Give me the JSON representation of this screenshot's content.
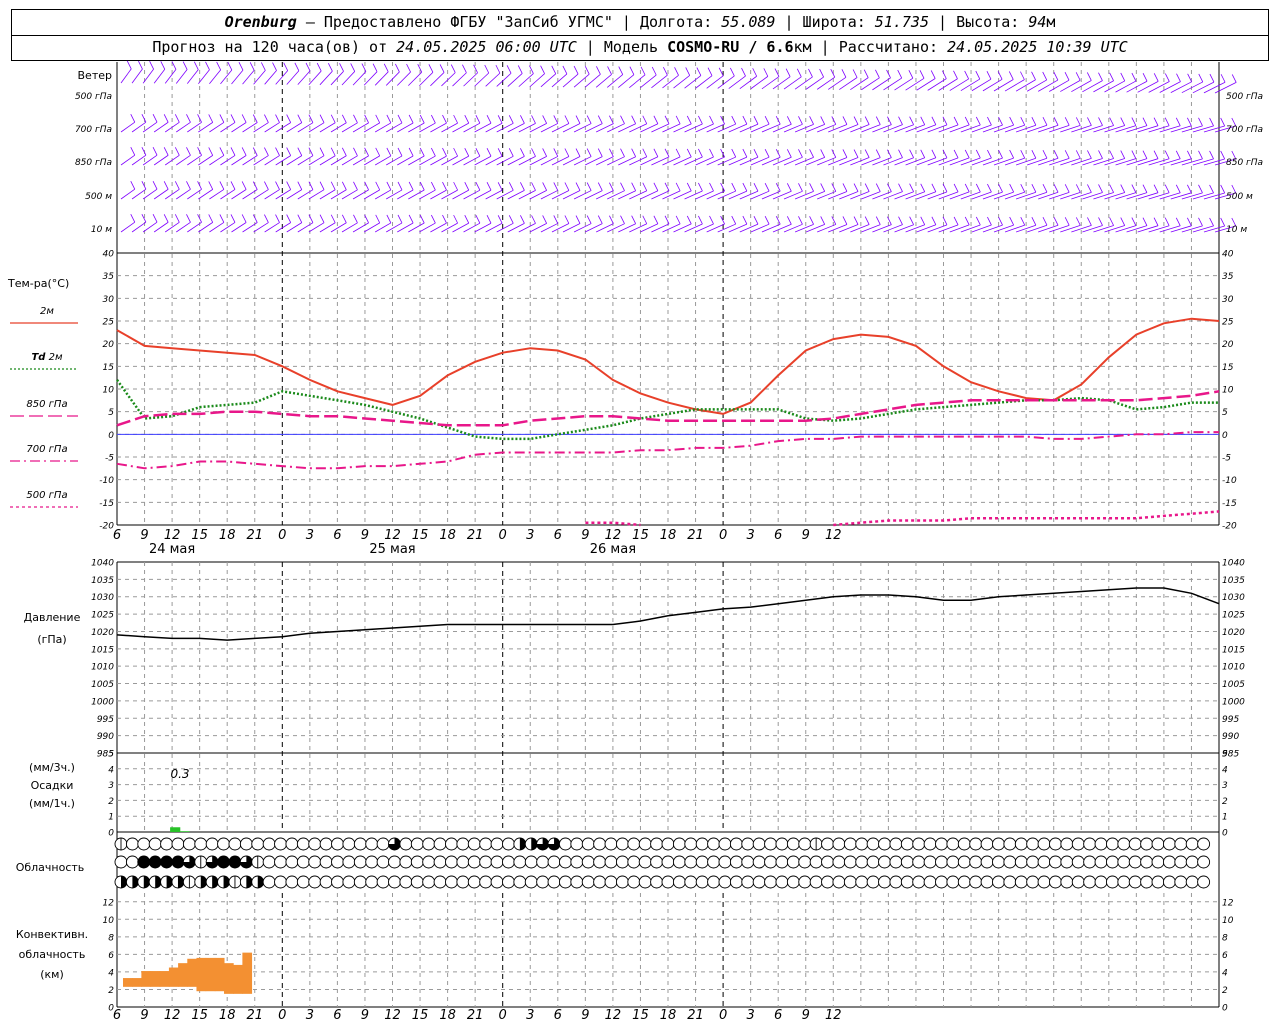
{
  "header": {
    "city": "Orenburg",
    "provided_by": "Предоставлено ФГБУ \"ЗапСиб УГМС\"",
    "lon_label": "Долгота:",
    "lon_value": "55.089",
    "lat_label": "Широта:",
    "lat_value": "51.735",
    "alt_label": "Высота:",
    "alt_value": "94",
    "alt_unit": "м",
    "forecast_text": "Прогноз на 120 часа(ов) от",
    "forecast_start": "24.05.2025 06:00 UTC",
    "model_label": "Модель",
    "model_name": "COSMO-RU / 6.6",
    "model_unit": "км",
    "calc_label": "Рассчитано:",
    "calc_time": "24.05.2025 10:39 UTC"
  },
  "time_axis": {
    "hour_labels": [
      "6",
      "9",
      "12",
      "15",
      "18",
      "21",
      "0",
      "3",
      "6",
      "9",
      "12",
      "15",
      "18",
      "21",
      "0",
      "3",
      "6",
      "9",
      "12",
      "15",
      "18",
      "21",
      "0",
      "3",
      "6",
      "9",
      "12"
    ],
    "day_labels": [
      {
        "text": "24 мая",
        "x_index": 2
      },
      {
        "text": "25 мая",
        "x_index": 10
      },
      {
        "text": "26 мая",
        "x_index": 18
      }
    ],
    "day_boundary_indices": [
      6,
      14,
      22
    ],
    "bottom_hour_labels": [
      "6",
      "9",
      "12",
      "15",
      "18",
      "21",
      "0",
      "3",
      "6",
      "9",
      "12",
      "15",
      "18",
      "21",
      "0",
      "3",
      "6",
      "9",
      "12",
      "15",
      "18",
      "21",
      "0",
      "3",
      "6",
      "9",
      "12"
    ]
  },
  "wind_panel": {
    "title": "Ветер",
    "levels": [
      "500 гПа",
      "700 гПа",
      "850 гПа",
      "500 м",
      "10 м"
    ],
    "right_levels": [
      "500 гПа",
      "700 гПа",
      "850 гПа",
      "500 м",
      "10 м"
    ],
    "color": "#7f00ff"
  },
  "chart_data": [
    {
      "type": "line",
      "id": "temperature",
      "title": "Тем-ра(°C)",
      "ylim": [
        -20,
        40
      ],
      "yticks": [
        -20,
        -15,
        -10,
        -5,
        0,
        5,
        10,
        15,
        20,
        25,
        30,
        35,
        40
      ],
      "x_hours": [
        0,
        3,
        6,
        9,
        12,
        15,
        18,
        21,
        24,
        27,
        30,
        33,
        36,
        39,
        42,
        45,
        48,
        51,
        54,
        57,
        60,
        63,
        66,
        69,
        72,
        75,
        78,
        81,
        84,
        87,
        90,
        93,
        96,
        99,
        102,
        105,
        108,
        111,
        114,
        117,
        120
      ],
      "series": [
        {
          "name": "2м",
          "style": "solid",
          "color": "#e8402a",
          "values": [
            23,
            19.5,
            19,
            18.5,
            18,
            17.5,
            15,
            12,
            9.5,
            8,
            6.5,
            8.5,
            13,
            16,
            18,
            19,
            18.5,
            16.5,
            12,
            9,
            7,
            5.5,
            4.5,
            7,
            13,
            18.5,
            21,
            22,
            21.5,
            19.5,
            15,
            11.5,
            9.5,
            8,
            7.5,
            11,
            17,
            22,
            24.5,
            25.5,
            25
          ]
        },
        {
          "name": "Td 2м",
          "style": "dotted",
          "color": "#1a8a1a",
          "values": [
            12,
            3.5,
            4,
            6,
            6.5,
            7,
            9.5,
            8.5,
            7.5,
            6.5,
            5,
            3.5,
            1.5,
            -0.5,
            -1,
            -1,
            0,
            1,
            2,
            3.5,
            4.5,
            5.5,
            5.5,
            5.5,
            5.5,
            3.5,
            3,
            3.5,
            4.5,
            5.5,
            6,
            6.5,
            7,
            7.5,
            7.5,
            8,
            7.5,
            5.5,
            6,
            7,
            7
          ]
        },
        {
          "name": "850 гПа",
          "style": "longdash",
          "color": "#e8178a",
          "values": [
            2,
            4,
            4.5,
            4.5,
            5,
            5,
            4.5,
            4,
            4,
            3.5,
            3,
            2.5,
            2,
            2,
            2,
            3,
            3.5,
            4,
            4,
            3.5,
            3,
            3,
            3,
            3,
            3,
            3,
            3.5,
            4.5,
            5.5,
            6.5,
            7,
            7.5,
            7.5,
            7.5,
            7.5,
            7.5,
            7.5,
            7.5,
            8,
            8.5,
            9.5
          ]
        },
        {
          "name": "700 гПа",
          "style": "dashdot",
          "color": "#e8178a",
          "values": [
            -6.5,
            -7.5,
            -7,
            -6,
            -6,
            -6.5,
            -7,
            -7.5,
            -7.5,
            -7,
            -7,
            -6.5,
            -6,
            -4.5,
            -4,
            -4,
            -4,
            -4,
            -4,
            -3.5,
            -3.5,
            -3,
            -3,
            -2.5,
            -1.5,
            -1,
            -1,
            -0.5,
            -0.5,
            -0.5,
            -0.5,
            -0.5,
            -0.5,
            -0.5,
            -1,
            -1,
            -0.5,
            0,
            0,
            0.5,
            0.5
          ]
        },
        {
          "name": "500 гПа",
          "style": "shortdash",
          "color": "#e8178a",
          "values": [
            null,
            null,
            null,
            null,
            null,
            null,
            null,
            null,
            null,
            null,
            null,
            null,
            null,
            null,
            null,
            null,
            null,
            -19.5,
            -19.5,
            -20,
            null,
            null,
            null,
            null,
            null,
            null,
            -20,
            -19.5,
            -19,
            -19,
            -19,
            -18.5,
            -18.5,
            -18.5,
            -18.5,
            -18.5,
            -18.5,
            -18.5,
            -18,
            -17.5,
            -17
          ]
        }
      ],
      "legend": [
        {
          "label": "2м",
          "style": "solid",
          "color": "#e8402a"
        },
        {
          "label_it": "Td",
          "label": " 2м",
          "style": "dotted",
          "color": "#1a8a1a"
        },
        {
          "label": "850 гПа",
          "style": "longdash",
          "color": "#e8178a"
        },
        {
          "label": "700 гПа",
          "style": "dashdot",
          "color": "#e8178a"
        },
        {
          "label": "500 гПа",
          "style": "shortdash",
          "color": "#e8178a"
        }
      ]
    },
    {
      "type": "line",
      "id": "pressure",
      "title": "Давление",
      "subtitle": "(гПа)",
      "ylim": [
        985,
        1040
      ],
      "yticks": [
        985,
        990,
        995,
        1000,
        1005,
        1010,
        1015,
        1020,
        1025,
        1030,
        1035,
        1040
      ],
      "x_hours": [
        0,
        3,
        6,
        9,
        12,
        15,
        18,
        21,
        24,
        27,
        30,
        33,
        36,
        39,
        42,
        45,
        48,
        51,
        54,
        57,
        60,
        63,
        66,
        69,
        72,
        75,
        78,
        81,
        84,
        87,
        90,
        93,
        96,
        99,
        102,
        105,
        108,
        111,
        114,
        117,
        120
      ],
      "series": [
        {
          "color": "#000000",
          "values": [
            1019,
            1018.5,
            1018,
            1018,
            1017.5,
            1018,
            1018.5,
            1019.5,
            1020,
            1020.5,
            1021,
            1021.5,
            1022,
            1022,
            1022,
            1022,
            1022,
            1022,
            1022,
            1023,
            1024.5,
            1025.5,
            1026.5,
            1027,
            1028,
            1029,
            1030,
            1030.5,
            1030.5,
            1030,
            1029,
            1029,
            1030,
            1030.5,
            1031,
            1031.5,
            1032,
            1032.5,
            1032.5,
            1031,
            1028
          ]
        }
      ]
    },
    {
      "type": "bar",
      "id": "precipitation",
      "title": "Осадки",
      "unit_3h": "(мм/3ч.)",
      "unit_1h": "(мм/1ч.)",
      "ylim": [
        0,
        5
      ],
      "yticks": [
        0,
        1,
        2,
        3,
        4,
        5
      ],
      "annotation": "0.3",
      "bars": [
        {
          "x_hour": 6,
          "value": 0.3,
          "color": "#27c227"
        },
        {
          "x_hour": 7,
          "value": 0.05,
          "color": "#27c227"
        }
      ]
    },
    {
      "type": "bar",
      "id": "convective",
      "title": "Конвективн.",
      "title2": "облачность",
      "unit": "(км)",
      "ylim": [
        0,
        13
      ],
      "yticks": [
        0,
        2,
        4,
        6,
        8,
        10,
        12
      ],
      "bars": [
        {
          "x_hour": 1,
          "bottom": 2.3,
          "top": 3.3
        },
        {
          "x_hour": 2,
          "bottom": 2.3,
          "top": 3.3
        },
        {
          "x_hour": 3,
          "bottom": 2.3,
          "top": 4.1
        },
        {
          "x_hour": 4,
          "bottom": 2.3,
          "top": 4.1
        },
        {
          "x_hour": 5,
          "bottom": 2.3,
          "top": 4.1
        },
        {
          "x_hour": 6,
          "bottom": 2.3,
          "top": 4.5
        },
        {
          "x_hour": 7,
          "bottom": 2.3,
          "top": 5.0
        },
        {
          "x_hour": 8,
          "bottom": 2.3,
          "top": 5.5
        },
        {
          "x_hour": 9,
          "bottom": 1.8,
          "top": 5.6
        },
        {
          "x_hour": 10,
          "bottom": 1.8,
          "top": 5.6
        },
        {
          "x_hour": 11,
          "bottom": 1.8,
          "top": 5.6
        },
        {
          "x_hour": 12,
          "bottom": 1.5,
          "top": 5.0
        },
        {
          "x_hour": 13,
          "bottom": 1.5,
          "top": 4.8
        },
        {
          "x_hour": 14,
          "bottom": 1.5,
          "top": 6.2
        }
      ],
      "color": "#f39032"
    }
  ],
  "clouds": {
    "title": "Облачность",
    "rows": [
      [
        1,
        0,
        0,
        0,
        0,
        0,
        0,
        0,
        0,
        0,
        0,
        0,
        0,
        0,
        0,
        0,
        0,
        0,
        0,
        0,
        0,
        0,
        0,
        0,
        3,
        0,
        0,
        0,
        0,
        0,
        0,
        0,
        0,
        0,
        0,
        2,
        2,
        3,
        3,
        0,
        0,
        0,
        0,
        0,
        0,
        0,
        0,
        0,
        0,
        0,
        0,
        0,
        0,
        0,
        0,
        0,
        0,
        0,
        0,
        0,
        0,
        1,
        0,
        0,
        0,
        0,
        0,
        0,
        0,
        0,
        0,
        0,
        0,
        0,
        0,
        0,
        0,
        0,
        0,
        0,
        0,
        0,
        0,
        0,
        0,
        0,
        0,
        0,
        0,
        0,
        0,
        0,
        0,
        0,
        0,
        0,
        0,
        0,
        0,
        0,
        0,
        0,
        0,
        0,
        0,
        0,
        0,
        0,
        0,
        0,
        0,
        0,
        0,
        0,
        0,
        0,
        0,
        0,
        0,
        0
      ],
      [
        0,
        0,
        4,
        4,
        4,
        4,
        3,
        1,
        3,
        4,
        4,
        3,
        1,
        0,
        0,
        0,
        0,
        0,
        0,
        0,
        0,
        0,
        0,
        0,
        0,
        0,
        0,
        0,
        0,
        0,
        0,
        0,
        0,
        0,
        0,
        0,
        0,
        0,
        0,
        0,
        0,
        0,
        0,
        0,
        0,
        0,
        0,
        0,
        0,
        0,
        0,
        0,
        0,
        0,
        0,
        0,
        0,
        0,
        0,
        0,
        0,
        0,
        0,
        0,
        0,
        0,
        0,
        0,
        0,
        0,
        0,
        0,
        0,
        0,
        0,
        0,
        0,
        0,
        0,
        0,
        0,
        0,
        0,
        0,
        0,
        0,
        0,
        0,
        0,
        0,
        0,
        0,
        0,
        0,
        0,
        0,
        0,
        0,
        0,
        0,
        0,
        0,
        0,
        0,
        0,
        0,
        0,
        0,
        0,
        0,
        0,
        0,
        0,
        0,
        0,
        0,
        0,
        0,
        0,
        0
      ],
      [
        2,
        2,
        2,
        2,
        2,
        2,
        1,
        2,
        2,
        2,
        1,
        2,
        2,
        0,
        0,
        0,
        0,
        0,
        0,
        0,
        0,
        0,
        0,
        0,
        0,
        0,
        0,
        0,
        0,
        0,
        0,
        0,
        0,
        0,
        0,
        0,
        0,
        0,
        0,
        0,
        0,
        0,
        0,
        0,
        0,
        0,
        0,
        0,
        0,
        0,
        0,
        0,
        0,
        0,
        0,
        0,
        0,
        0,
        0,
        0,
        0,
        0,
        0,
        0,
        0,
        0,
        0,
        0,
        0,
        0,
        0,
        0,
        0,
        0,
        0,
        0,
        0,
        0,
        0,
        0,
        0,
        0,
        0,
        0,
        0,
        0,
        0,
        0,
        0,
        0,
        0,
        0,
        0,
        0,
        0,
        0,
        0,
        0,
        0,
        0,
        0,
        0,
        0,
        0,
        0,
        0,
        0,
        0,
        0,
        0,
        0,
        0,
        0,
        0,
        0,
        0,
        0,
        0,
        0,
        0
      ]
    ]
  }
}
